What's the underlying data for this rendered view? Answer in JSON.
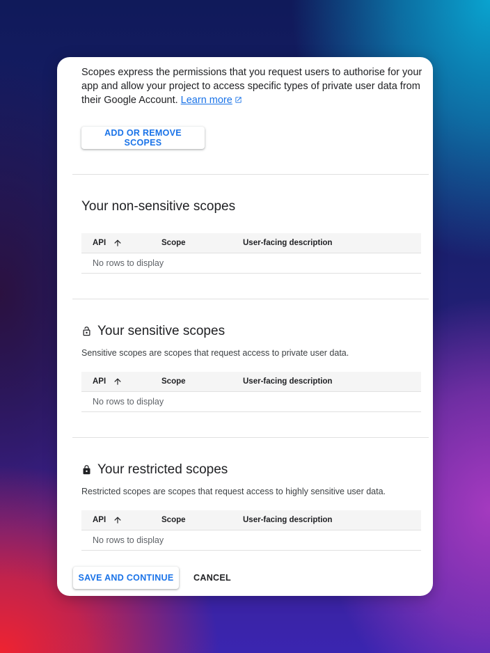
{
  "intro": {
    "text": "Scopes express the permissions that you request users to authorise for your app and allow your project to access specific types of private user data from their Google Account. ",
    "learn_more": "Learn more"
  },
  "add_remove_label": "ADD OR REMOVE SCOPES",
  "columns": {
    "api": "API",
    "scope": "Scope",
    "description": "User-facing description"
  },
  "sections": {
    "non_sensitive": {
      "title": "Your non-sensitive scopes",
      "empty": "No rows to display"
    },
    "sensitive": {
      "title": "Your sensitive scopes",
      "description": "Sensitive scopes are scopes that request access to private user data.",
      "empty": "No rows to display"
    },
    "restricted": {
      "title": "Your restricted scopes",
      "description": "Restricted scopes are scopes that request access to highly sensitive user data.",
      "empty": "No rows to display"
    }
  },
  "footer": {
    "save_label": "SAVE AND CONTINUE",
    "cancel_label": "CANCEL"
  },
  "icons": {
    "sort": "arrow-up-icon",
    "lock_open": "lock-open-icon",
    "lock": "lock-icon",
    "external": "external-link-icon"
  },
  "colors": {
    "accent": "#1a73e8",
    "text": "#202124"
  }
}
